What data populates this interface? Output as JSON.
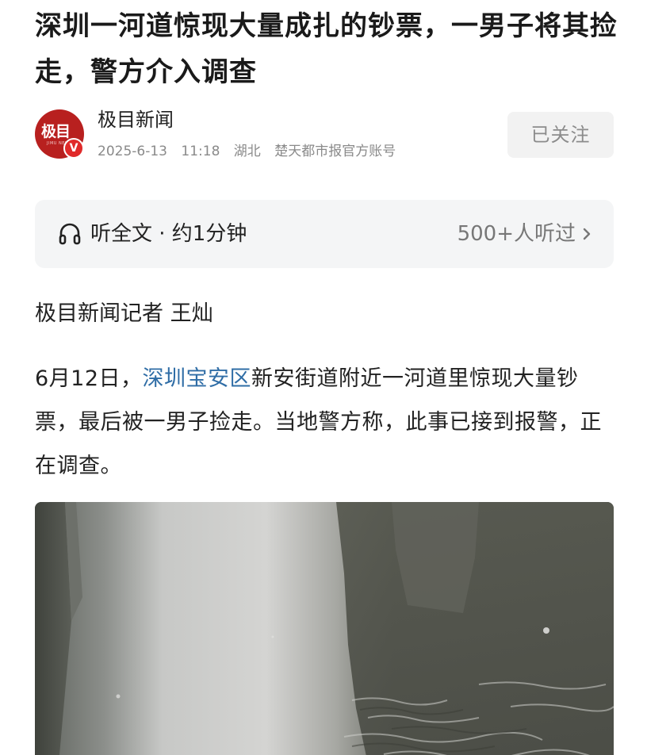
{
  "article": {
    "title": "深圳一河道惊现大量成扎的钞票，一男子将其捡走，警方介入调查"
  },
  "author": {
    "avatar_text": "极目",
    "avatar_subtext": "JIMU NEWS",
    "verified_mark": "V",
    "source_name": "极目新闻",
    "date": "2025-6-13",
    "time": "11:18",
    "region": "湖北",
    "account": "楚天都市报官方账号",
    "follow_label": "已关注"
  },
  "listen": {
    "label": "听全文 · 约1分钟",
    "count": "500+人听过"
  },
  "body": {
    "byline": "极目新闻记者 王灿",
    "para_prefix": "6月12日，",
    "location": "深圳宝安区",
    "para_rest": "新安街道附近一河道里惊现大量钞票，最后被一男子捡走。当地警方称，此事已接到报警，正在调查。"
  },
  "colors": {
    "accent_red": "#b8201f",
    "link_blue": "#2f6da6",
    "muted_gray": "#8a8a8a"
  },
  "icons": {
    "headphones": "headphones-icon",
    "chevron": "chevron-right-icon",
    "verified": "verified-badge"
  }
}
